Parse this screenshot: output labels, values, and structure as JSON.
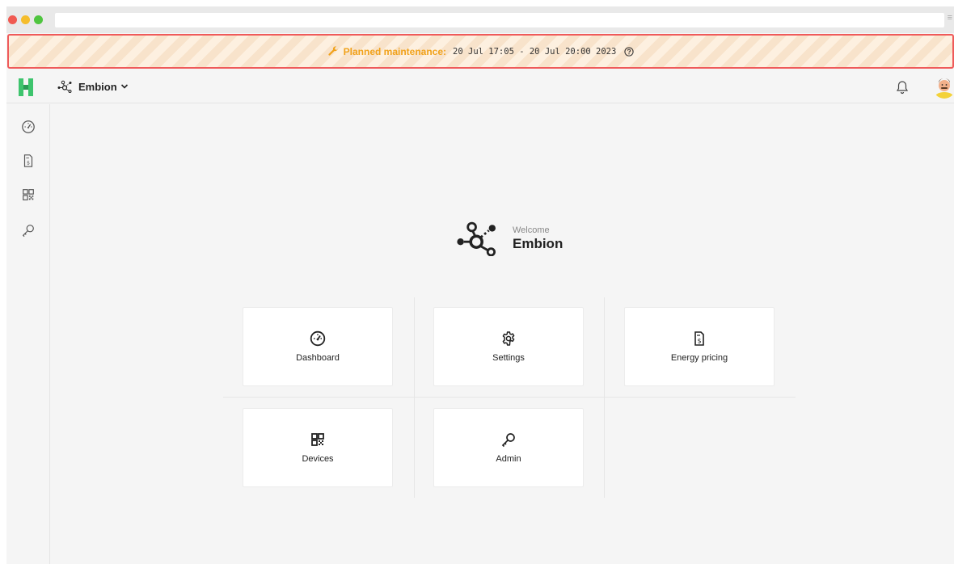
{
  "banner": {
    "title": "Planned maintenance:",
    "range": "20 Jul 17:05 - 20 Jul 20:00 2023"
  },
  "topbar": {
    "site_name": "Embion"
  },
  "sidebar": {
    "items": [
      {
        "name": "dashboard",
        "icon": "speedometer-icon"
      },
      {
        "name": "energy-pricing",
        "icon": "invoice-icon"
      },
      {
        "name": "devices",
        "icon": "qr-code-icon"
      },
      {
        "name": "admin",
        "icon": "key-icon"
      }
    ]
  },
  "welcome": {
    "greeting": "Welcome",
    "site": "Embion"
  },
  "cards": [
    {
      "label": "Dashboard",
      "icon": "speedometer-icon"
    },
    {
      "label": "Settings",
      "icon": "gear-icon"
    },
    {
      "label": "Energy pricing",
      "icon": "invoice-icon"
    },
    {
      "label": "Devices",
      "icon": "qr-code-icon"
    },
    {
      "label": "Admin",
      "icon": "key-icon"
    }
  ],
  "colors": {
    "banner_border": "#ef5a5a",
    "banner_title": "#f1a21b",
    "logo_green": "#3ec46d"
  }
}
